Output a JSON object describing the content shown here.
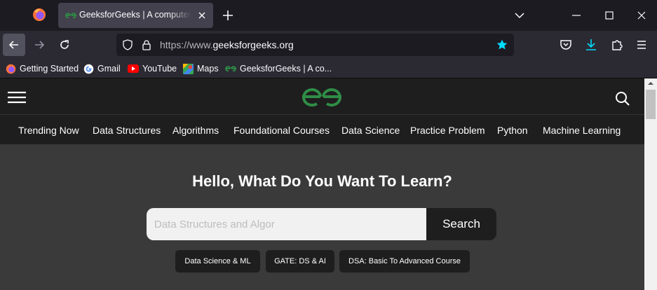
{
  "browser": {
    "tab": {
      "title": "GeeksforGeeks | A computer science portal for geeks"
    },
    "url": {
      "scheme": "https://www.",
      "host": "geeksforgeeks.org"
    },
    "bookmarks": [
      {
        "label": "Getting Started",
        "icon": "firefox-icon"
      },
      {
        "label": "Gmail",
        "icon": "google-icon"
      },
      {
        "label": "YouTube",
        "icon": "youtube-icon"
      },
      {
        "label": "Maps",
        "icon": "maps-icon"
      },
      {
        "label": "GeeksforGeeks | A co...",
        "icon": "gfg-icon"
      }
    ],
    "colors": {
      "accent": "#0df",
      "tab_bg": "#42414d",
      "toolbar_bg": "#2b2a33"
    }
  },
  "site": {
    "nav": [
      "Trending Now",
      "Data Structures",
      "Algorithms",
      "Foundational Courses",
      "Data Science",
      "Practice Problem",
      "Python",
      "Machine Learning"
    ],
    "hero": {
      "title": "Hello, What Do You Want To Learn?"
    },
    "search": {
      "placeholder": "Data Structures and Algor",
      "button": "Search"
    },
    "chips": [
      "Data Science & ML",
      "GATE: DS & AI",
      "DSA: Basic To Advanced Course"
    ],
    "colors": {
      "brand_green": "#2f8d46",
      "header_bg": "#1e1e1e",
      "body_bg": "#3a3a3a"
    }
  }
}
